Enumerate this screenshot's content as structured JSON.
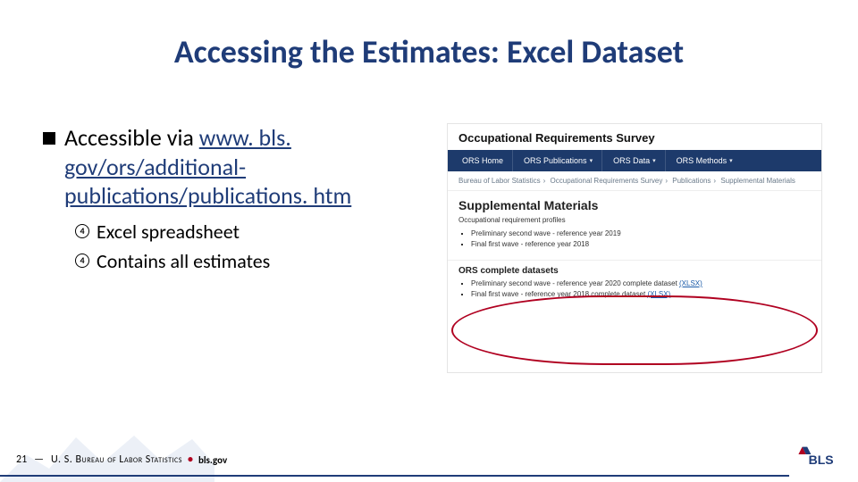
{
  "title": "Accessing the Estimates: Excel Dataset",
  "bullet": {
    "lead": "Accessible via ",
    "link": "www. bls. gov/ors/additional-publications/publications. htm"
  },
  "sub_bullets": {
    "marker": "4",
    "items": [
      "Excel spreadsheet",
      "Contains all estimates"
    ]
  },
  "thumbnail": {
    "page_title": "Occupational Requirements Survey",
    "nav": [
      {
        "label": "ORS Home",
        "caret": false
      },
      {
        "label": "ORS Publications",
        "caret": true
      },
      {
        "label": "ORS Data",
        "caret": true
      },
      {
        "label": "ORS Methods",
        "caret": true
      }
    ],
    "crumbs": [
      "Bureau of Labor Statistics",
      "Occupational Requirements Survey",
      "Publications",
      "Supplemental Materials"
    ],
    "h2": "Supplemental Materials",
    "section1_title": "Occupational requirement profiles",
    "section1_items": [
      "Preliminary second wave - reference year 2019",
      "Final first wave - reference year 2018"
    ],
    "section2_title": "ORS complete datasets",
    "section2_items": [
      {
        "text": "Preliminary second wave - reference year 2020 complete dataset ",
        "suffix": "(XLSX)"
      },
      {
        "text": "Final first wave - reference year 2018 complete dataset ",
        "suffix": "(XLSX)"
      }
    ]
  },
  "footer": {
    "page_number": "21",
    "dash": "—",
    "bureau_text": "U. S. Bureau of Labor Statistics",
    "dot": "•",
    "site": "bls.gov"
  },
  "logo_text": "BLS"
}
